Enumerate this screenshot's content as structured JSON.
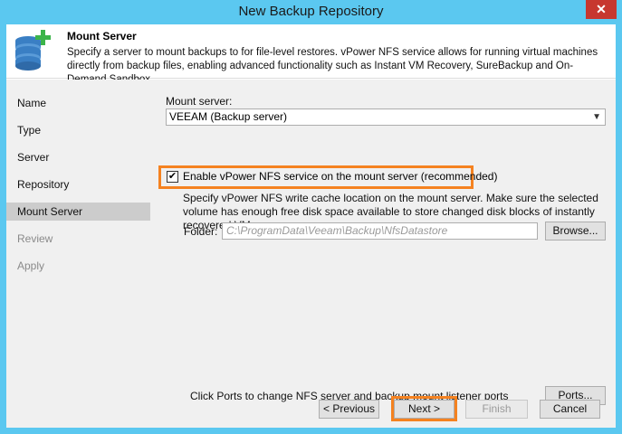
{
  "window": {
    "title": "New Backup Repository",
    "close_glyph": "✕"
  },
  "header": {
    "title": "Mount Server",
    "description": "Specify a server to mount backups to for file-level restores. vPower NFS service allows for running virtual machines directly from backup files, enabling advanced functionality such as Instant VM Recovery, SureBackup and On-Demand Sandbox.",
    "icon": "database-add-icon",
    "icon_colors": {
      "database": "#3a7fc4",
      "plus": "#3cb44a"
    }
  },
  "nav": {
    "items": [
      {
        "label": "Name",
        "state": "normal"
      },
      {
        "label": "Type",
        "state": "normal"
      },
      {
        "label": "Server",
        "state": "normal"
      },
      {
        "label": "Repository",
        "state": "normal"
      },
      {
        "label": "Mount Server",
        "state": "active"
      },
      {
        "label": "Review",
        "state": "disabled"
      },
      {
        "label": "Apply",
        "state": "disabled"
      }
    ]
  },
  "mount_server": {
    "label": "Mount server:",
    "selected": "VEEAM (Backup server)"
  },
  "nfs": {
    "checkbox_label": "Enable vPower NFS service on the mount server (recommended)",
    "checked": true,
    "description": "Specify vPower NFS write cache location on the mount server. Make sure the selected volume has enough free disk space available to store changed disk blocks of instantly recovered VMs.",
    "folder_label": "Folder:",
    "folder_value": "C:\\ProgramData\\Veeam\\Backup\\NfsDatastore",
    "browse_label": "Browse..."
  },
  "ports": {
    "hint": "Click Ports to change NFS server and backup mount listener ports",
    "button_label": "Ports..."
  },
  "footer": {
    "previous_label": "< Previous",
    "next_label": "Next >",
    "finish_label": "Finish",
    "cancel_label": "Cancel"
  },
  "colors": {
    "titlebar": "#5bc8f0",
    "highlight": "#f58220",
    "close": "#c7372f",
    "nav_active": "#cccccc"
  }
}
